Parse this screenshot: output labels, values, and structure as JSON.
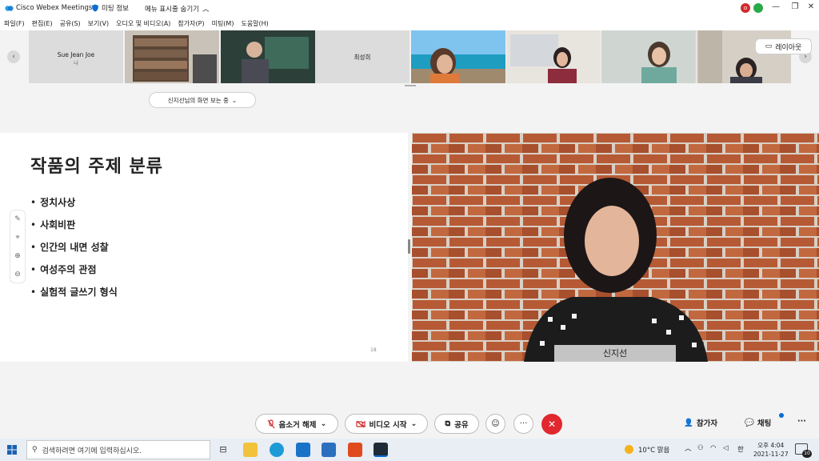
{
  "window": {
    "app_title": "Cisco Webex Meetings",
    "meeting_info": "미팅 정보",
    "hide_menu": "메뉴 표시줄 숨기기",
    "user_initial": "o"
  },
  "menu": [
    "파일(F)",
    "편집(E)",
    "공유(S)",
    "보기(V)",
    "오디오 및 비디오(A)",
    "참가자(P)",
    "미팅(M)",
    "도움말(H)"
  ],
  "strip": {
    "tiles": [
      {
        "name": "Sue Jean Joe",
        "sub": "나"
      },
      {
        "name": ""
      },
      {
        "name": ""
      },
      {
        "name": "최성희"
      },
      {
        "name": ""
      },
      {
        "name": ""
      },
      {
        "name": ""
      },
      {
        "name": ""
      }
    ],
    "viewing_label": "신지선님의 화면 보는 중",
    "layout_label": "레이아웃"
  },
  "slide": {
    "title": "작품의 주제 분류",
    "bullets": [
      "정치사상",
      "사회비판",
      "인간의 내면 성찰",
      "여성주의 관점",
      "실험적 글쓰기 형식"
    ],
    "page_number": "18"
  },
  "video": {
    "speaker_name": "신지선"
  },
  "controls": {
    "unmute": "음소거 해제",
    "start_video": "비디오 시작",
    "share": "공유",
    "participants": "참가자",
    "chat": "채팅"
  },
  "taskbar": {
    "search_placeholder": "검색하려면 여기에 입력하십시오.",
    "weather": "10°C 맑음",
    "ime": "한",
    "time": "오후 4:04",
    "date": "2021-11-27",
    "notif_count": "10"
  },
  "colors": {
    "end_button": "#e0282e",
    "webex_blue": "#0a6cd4"
  }
}
